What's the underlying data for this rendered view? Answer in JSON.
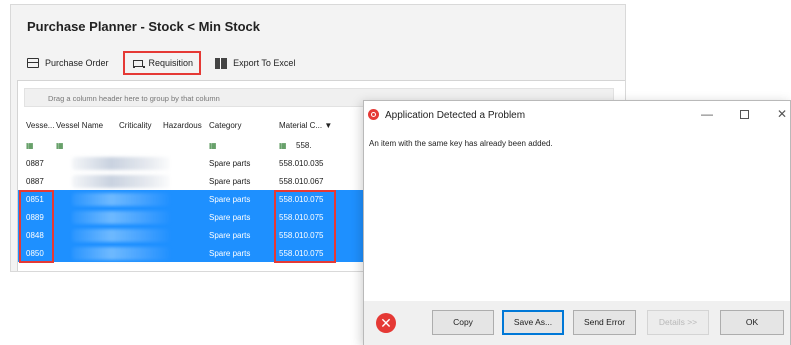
{
  "app": {
    "title": "Purchase Planner - Stock < Min Stock",
    "toolbar": {
      "purchase_order": "Purchase Order",
      "requisition": "Requisition",
      "export_excel": "Export To Excel"
    },
    "grid": {
      "group_hint": "Drag a column header here to group by that column",
      "columns": {
        "vessel": "Vesse...",
        "vessel_name": "Vessel Name",
        "criticality": "Criticality",
        "hazardous": "Hazardous",
        "category": "Category",
        "material": "Material C..."
      },
      "filter_material": "558.",
      "rows": [
        {
          "vessel": "0887",
          "category": "Spare parts",
          "material": "558.010.035",
          "selected": false
        },
        {
          "vessel": "0887",
          "category": "Spare parts",
          "material": "558.010.067",
          "selected": false
        },
        {
          "vessel": "0851",
          "category": "Spare parts",
          "material": "558.010.075",
          "selected": true
        },
        {
          "vessel": "0889",
          "category": "Spare parts",
          "material": "558.010.075",
          "selected": true
        },
        {
          "vessel": "0848",
          "category": "Spare parts",
          "material": "558.010.075",
          "selected": true
        },
        {
          "vessel": "0850",
          "category": "Spare parts",
          "material": "558.010.075",
          "selected": true
        }
      ]
    }
  },
  "dialog": {
    "title": "Application Detected a Problem",
    "message": "An item with the same key has already been added.",
    "buttons": {
      "copy": "Copy",
      "save_as": "Save As...",
      "send_error": "Send Error",
      "details": "Details >>",
      "ok": "OK"
    }
  },
  "colors": {
    "selection": "#1e90ff",
    "highlight_box": "#e53935",
    "error_icon": "#e53935"
  }
}
